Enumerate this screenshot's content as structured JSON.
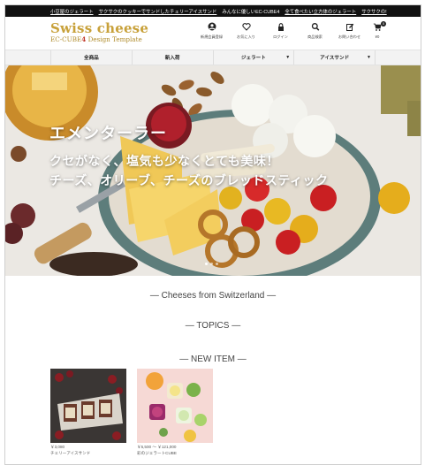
{
  "topbar": {
    "links": [
      "小豆屋のジェラート",
      "サクサクのクッキーでサンドしたチェリーアイスサンド"
    ],
    "text": "みんなに優しいEC-CUBE4",
    "links2": [
      "全て食べたい立方体のジェラート",
      "サクサクの!"
    ]
  },
  "logo": {
    "title": "Swiss cheese",
    "sub_prefix": "EC-CUBE",
    "sub_version": "4",
    "sub_suffix": " Design Template"
  },
  "icons": [
    {
      "name": "user-icon",
      "glyph": "●",
      "label": "新規会員登録"
    },
    {
      "name": "heart-icon",
      "glyph": "♡",
      "label": "お気に入り"
    },
    {
      "name": "lock-icon",
      "glyph": "■",
      "label": "ログイン"
    },
    {
      "name": "search-icon",
      "glyph": "⌕",
      "label": "商品検索"
    },
    {
      "name": "edit-icon",
      "glyph": "✎",
      "label": "お問い合わせ"
    }
  ],
  "cart": {
    "count": "0",
    "price": "¥0"
  },
  "nav": [
    {
      "label": "全商品",
      "dropdown": false
    },
    {
      "label": "新入荷",
      "dropdown": false
    },
    {
      "label": "ジェラート",
      "dropdown": true
    },
    {
      "label": "アイスサンド",
      "dropdown": true
    }
  ],
  "hero": {
    "title": "エメンターラー",
    "line1": "クセがなく、塩気も少なくとても美味！",
    "line2": "チーズ、オリーブ、チーズのブレッドスティック"
  },
  "sections": {
    "cheeses": "— Cheeses from Switzerland —",
    "topics": "— TOPICS —",
    "new_item": "— NEW ITEM —"
  },
  "products": [
    {
      "price": "￥3,080",
      "name": "チェリーアイスサンド"
    },
    {
      "price": "￥5,500 ～ ￥121,000",
      "name": "彩のジェラートCUBE"
    }
  ]
}
